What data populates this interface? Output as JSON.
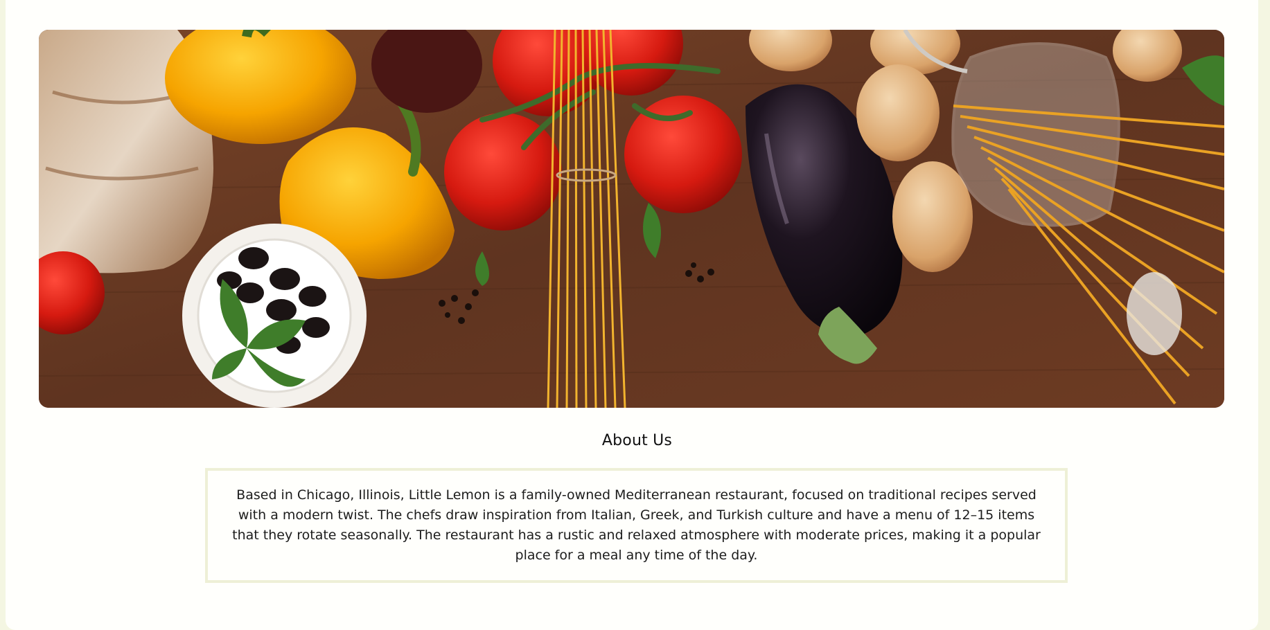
{
  "hero": {
    "image_alt": "Mediterranean ingredients on a wooden table: bread, bell peppers, olives with basil, tomatoes, spaghetti, eggplant, onions and a jar of pasta"
  },
  "about": {
    "title": "About Us",
    "body": "Based in Chicago, Illinois, Little Lemon is a family-owned Mediterranean restaurant, focused on traditional recipes served with a modern twist. The chefs draw inspiration from Italian, Greek, and Turkish culture and have a menu of 12–15 items that they rotate seasonally. The restaurant has a rustic and relaxed atmosphere with moderate prices, making it a popular place for a meal any time of the day."
  },
  "colors": {
    "page_background": "#f4f6e2",
    "card_background": "#fffffc",
    "box_border": "#eef0d6",
    "wood": "#6a3a22"
  }
}
